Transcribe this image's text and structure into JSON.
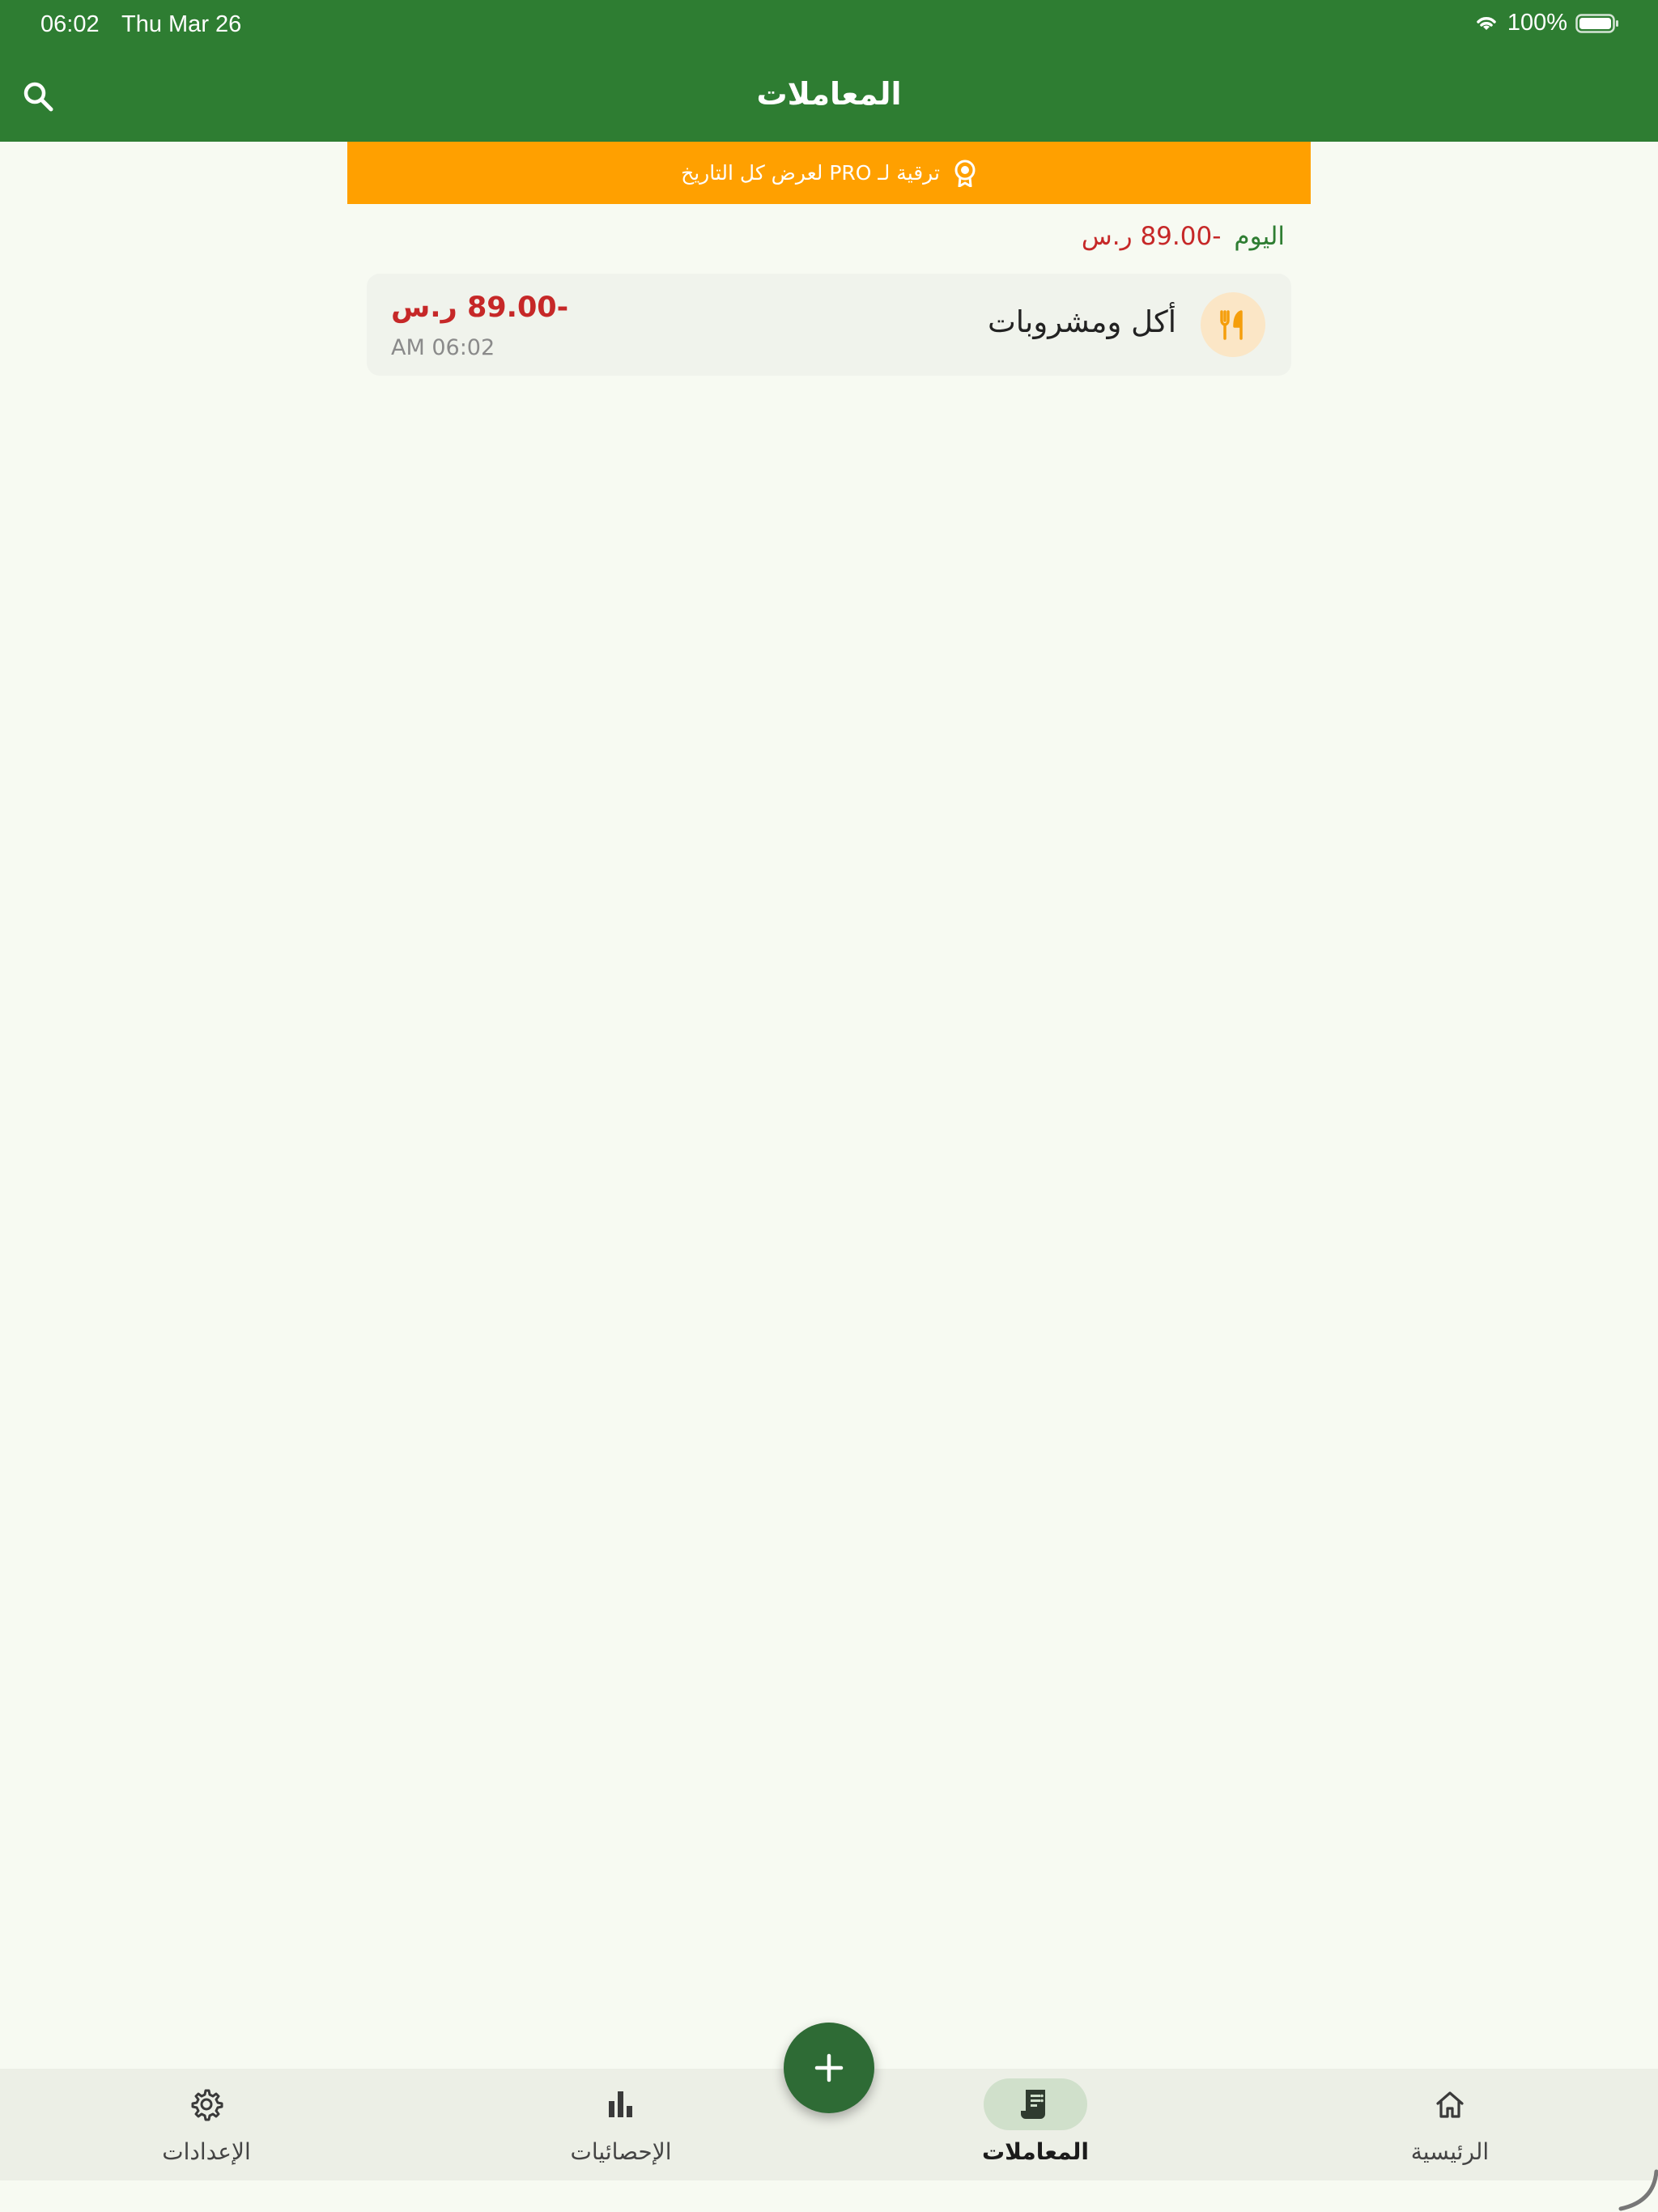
{
  "status_bar": {
    "time": "06:02",
    "date": "Thu Mar 26",
    "battery": "100%"
  },
  "app_bar": {
    "title": "المعاملات",
    "search_icon": "search-icon"
  },
  "pro_banner": {
    "text": "ترقية لـ PRO لعرض كل التاريخ",
    "icon": "award-icon",
    "color": "#ffa000"
  },
  "day_group": {
    "label": "اليوم",
    "total": "-89.00 ر.س",
    "transactions": [
      {
        "category": "أكل ومشروبات",
        "amount": "-89.00 ر.س",
        "time": "AM 06:02",
        "icon": "restaurant-icon"
      }
    ]
  },
  "bottom_nav": {
    "items": [
      {
        "label": "الإعدادات",
        "icon": "settings-icon"
      },
      {
        "label": "الإحصائيات",
        "icon": "bar-chart-icon"
      },
      {
        "label": "المعاملات",
        "icon": "receipt-icon",
        "active": true
      },
      {
        "label": "الرئيسية",
        "icon": "home-icon"
      }
    ]
  },
  "fab": {
    "icon": "plus-icon"
  },
  "colors": {
    "primary": "#2e7d32",
    "expense": "#c62828",
    "accent": "#ffa000",
    "background": "#f7faf2"
  }
}
